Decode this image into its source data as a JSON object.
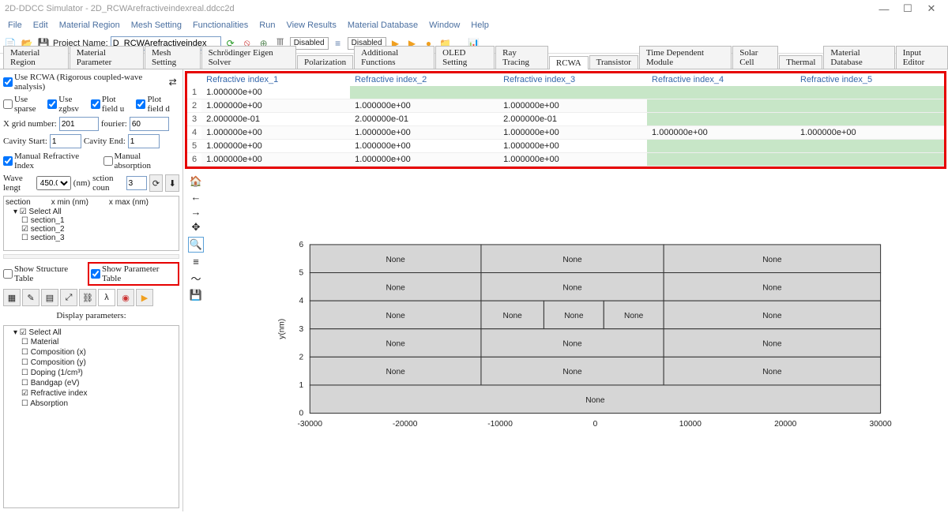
{
  "window": {
    "title": "2D-DDCC Simulator - 2D_RCWArefractiveindexreal.ddcc2d",
    "minimize": "—",
    "maximize": "☐",
    "close": "✕"
  },
  "menu": [
    "File",
    "Edit",
    "Material Region",
    "Mesh Setting",
    "Functionalities",
    "Run",
    "View Results",
    "Material Database",
    "Window",
    "Help"
  ],
  "toolbar": {
    "project_label": "Project Name:",
    "project_value": "D_RCWArefractiveindex",
    "disabled1": "Disabled",
    "disabled2": "Disabled"
  },
  "tabs": [
    "Material Region",
    "Material Parameter",
    "Mesh Setting",
    "Schrödinger Eigen Solver",
    "Polarization",
    "Additional Functions",
    "OLED Setting",
    "Ray Tracing",
    "RCWA",
    "Transistor",
    "Time Dependent Module",
    "Solar Cell",
    "Thermal",
    "Material Database",
    "Input Editor"
  ],
  "active_tab": "RCWA",
  "sidebar": {
    "use_rcwa": "Use RCWA (Rigorous coupled-wave analysis)",
    "use_sparse": "Use sparse",
    "use_zgbsv": "Use zgbsv",
    "plot_u": "Plot field u",
    "plot_d": "Plot field d",
    "xgrid_label": "X grid number:",
    "xgrid_value": "201",
    "fourier_label": "fourier:",
    "fourier_value": "60",
    "cavity_start_label": "Cavity Start:",
    "cavity_start_value": "1",
    "cavity_end_label": "Cavity End:",
    "cavity_end_value": "1",
    "manual_refr": "Manual Refractive Index",
    "manual_abs": "Manual absorption",
    "wave_label": "Wave lengt",
    "wave_value": "450.0",
    "wave_unit": "(nm)",
    "section_count_label": "sction coun",
    "section_count": "3",
    "tree_headers": [
      "section",
      "x min (nm)",
      "x max (nm)"
    ],
    "select_all": "Select All",
    "sections": [
      "section_1",
      "section_2",
      "section_3"
    ],
    "show_structure": "Show Structure Table",
    "show_parameter": "Show Parameter Table",
    "display_params": "Display parameters:",
    "params": [
      "Material",
      "Composition (x)",
      "Composition (y)",
      "Doping (1/cm³)",
      "Bandgap (eV)",
      "Refractive index",
      "Absorption"
    ]
  },
  "reftable": {
    "headers": [
      "Refractive index_1",
      "Refractive index_2",
      "Refractive index_3",
      "Refractive index_4",
      "Refractive index_5"
    ],
    "rows": [
      {
        "i": "1",
        "v": [
          "1.000000e+00",
          "",
          "",
          "",
          ""
        ],
        "green": [
          1,
          2,
          3,
          4
        ]
      },
      {
        "i": "2",
        "v": [
          "1.000000e+00",
          "1.000000e+00",
          "1.000000e+00",
          "",
          ""
        ],
        "green": [
          3,
          4
        ]
      },
      {
        "i": "3",
        "v": [
          "2.000000e-01",
          "2.000000e-01",
          "2.000000e-01",
          "",
          ""
        ],
        "green": [
          3,
          4
        ]
      },
      {
        "i": "4",
        "v": [
          "1.000000e+00",
          "1.000000e+00",
          "1.000000e+00",
          "1.000000e+00",
          "1.000000e+00"
        ],
        "green": []
      },
      {
        "i": "5",
        "v": [
          "1.000000e+00",
          "1.000000e+00",
          "1.000000e+00",
          "",
          ""
        ],
        "green": [
          3,
          4
        ]
      },
      {
        "i": "6",
        "v": [
          "1.000000e+00",
          "1.000000e+00",
          "1.000000e+00",
          "",
          ""
        ],
        "green": [
          3,
          4
        ]
      }
    ]
  },
  "chart_data": {
    "type": "table",
    "ylabel": "y(nm)",
    "yticks": [
      0,
      1,
      2,
      3,
      4,
      5,
      6
    ],
    "xticks": [
      -30000,
      -20000,
      -10000,
      0,
      10000,
      20000,
      30000
    ],
    "grid_rows": 6,
    "cells": [
      {
        "row": 0,
        "cols": 3,
        "labels": [
          "None",
          "None",
          "None"
        ]
      },
      {
        "row": 1,
        "cols": 3,
        "labels": [
          "None",
          "None",
          "None"
        ]
      },
      {
        "row": 2,
        "cols": 5,
        "labels": [
          "None",
          "None",
          "None",
          "None",
          "None"
        ]
      },
      {
        "row": 3,
        "cols": 3,
        "labels": [
          "None",
          "None",
          "None"
        ]
      },
      {
        "row": 4,
        "cols": 3,
        "labels": [
          "None",
          "None",
          "None"
        ]
      },
      {
        "row": 5,
        "cols": 1,
        "labels": [
          "None"
        ]
      }
    ]
  }
}
